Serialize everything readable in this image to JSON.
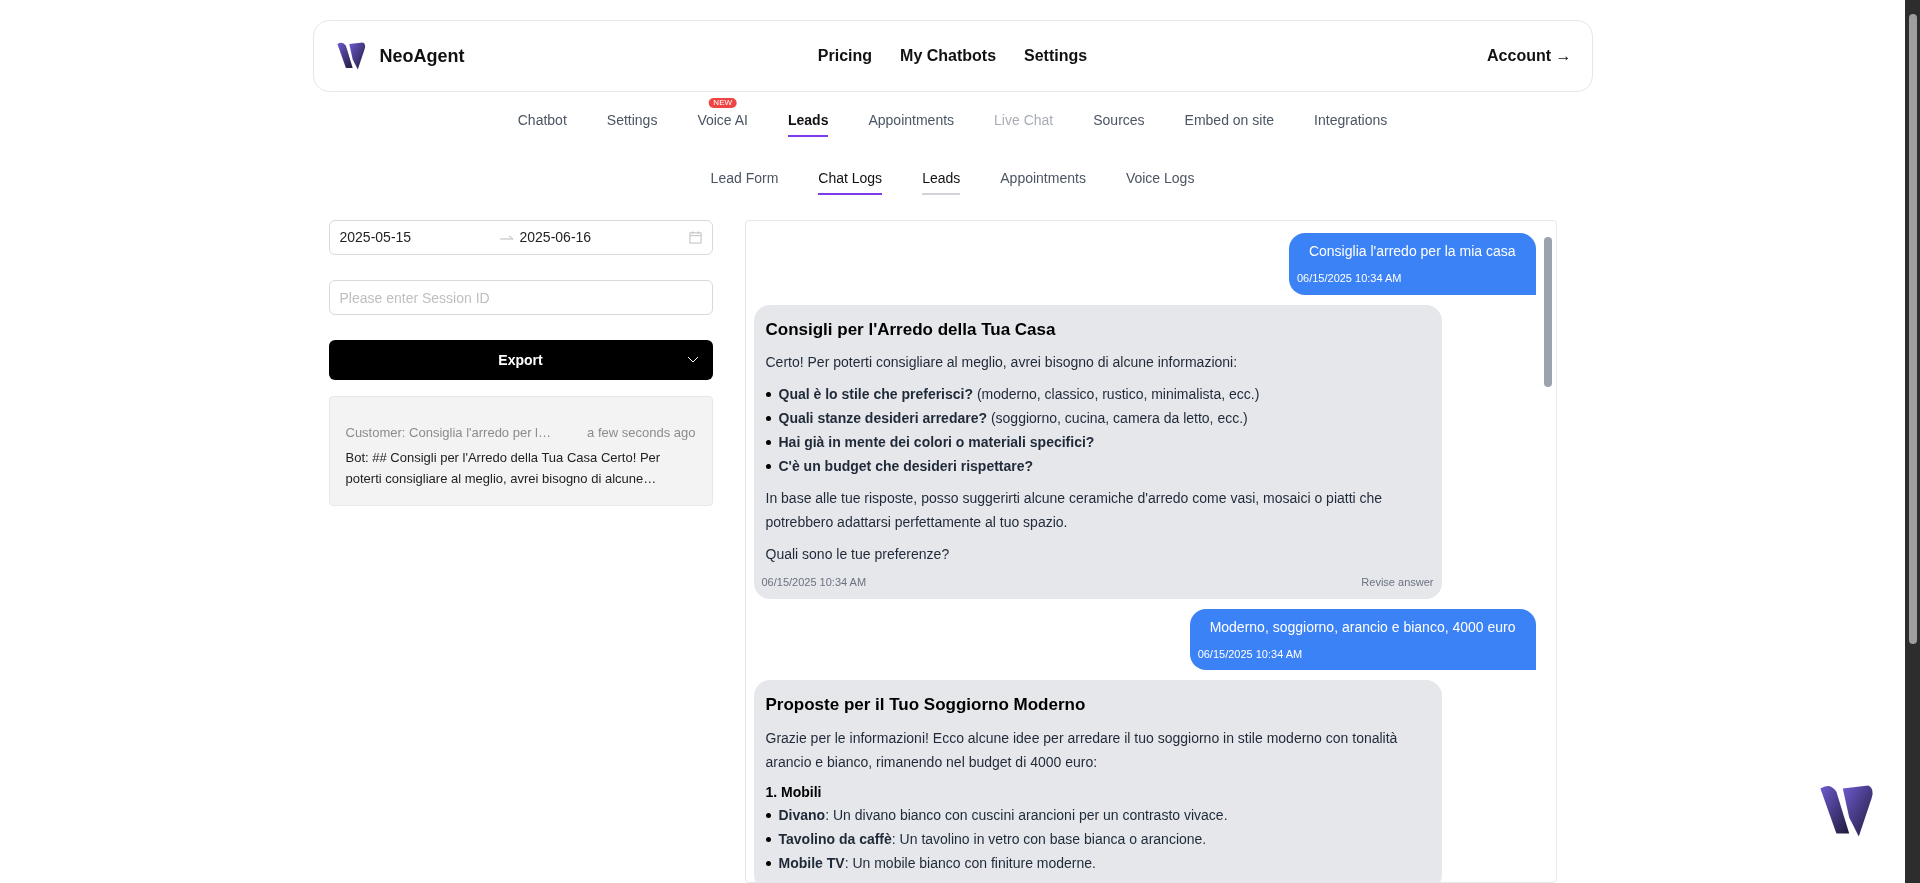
{
  "header": {
    "brand": "NeoAgent",
    "links": [
      "Pricing",
      "My Chatbots",
      "Settings"
    ],
    "account": "Account →"
  },
  "tabs": [
    {
      "label": "Chatbot",
      "selected": false,
      "disabled": false
    },
    {
      "label": "Settings",
      "selected": false,
      "disabled": false
    },
    {
      "label": "Voice AI",
      "selected": false,
      "disabled": false,
      "badge": "NEW"
    },
    {
      "label": "Leads",
      "selected": true,
      "disabled": false
    },
    {
      "label": "Appointments",
      "selected": false,
      "disabled": false
    },
    {
      "label": "Live Chat",
      "selected": false,
      "disabled": true
    },
    {
      "label": "Sources",
      "selected": false,
      "disabled": false
    },
    {
      "label": "Embed on site",
      "selected": false,
      "disabled": false
    },
    {
      "label": "Integrations",
      "selected": false,
      "disabled": false
    }
  ],
  "subtabs": [
    {
      "label": "Lead Form",
      "selected": false,
      "hovered": false
    },
    {
      "label": "Chat Logs",
      "selected": true,
      "hovered": false
    },
    {
      "label": "Leads",
      "selected": false,
      "hovered": true
    },
    {
      "label": "Appointments",
      "selected": false,
      "hovered": false
    },
    {
      "label": "Voice Logs",
      "selected": false,
      "hovered": false
    }
  ],
  "filters": {
    "date_from": "2025-05-15",
    "date_to": "2025-06-16",
    "session_placeholder": "Please enter Session ID",
    "export": "Export"
  },
  "sessions": [
    {
      "customer": "Customer: Consiglia l'arredo per l…",
      "time": "a few seconds ago",
      "bot": "Bot: ## Consigli per l'Arredo della Tua Casa Certo! Per poterti consigliare al meglio, avrei bisogno di alcune…",
      "selected": false
    }
  ],
  "messages": [
    {
      "kind": "user",
      "text": "Consiglia l'arredo per la mia casa",
      "time": "06/15/2025 10:34 AM"
    },
    {
      "kind": "bot",
      "time": "06/15/2025 10:34 AM",
      "action": "Revise answer",
      "blocks": [
        {
          "kind": "heading",
          "text": "Consigli per l'Arredo della Tua Casa"
        },
        {
          "kind": "paragraph",
          "text": "Certo! Per poterti consigliare al meglio, avrei bisogno di alcune informazioni:"
        },
        {
          "kind": "list",
          "items": [
            "**Qual è lo stile che preferisci?** (moderno, classico, rustico, minimalista, ecc.)",
            "**Quali stanze desideri arredare?** (soggiorno, cucina, camera da letto, ecc.)",
            "**Hai già in mente dei colori o materiali specifici?**",
            "**C'è un budget che desideri rispettare?**"
          ]
        },
        {
          "kind": "paragraph",
          "text": "In base alle tue risposte, posso suggerirti alcune ceramiche d'arredo come vasi, mosaici o piatti che potrebbero adattarsi perfettamente al tuo spazio."
        },
        {
          "kind": "paragraph",
          "text": "Quali sono le tue preferenze?"
        }
      ]
    },
    {
      "kind": "user",
      "text": "Moderno, soggiorno, arancio e bianco, 4000 euro",
      "time": "06/15/2025 10:34 AM"
    },
    {
      "kind": "bot",
      "blocks": [
        {
          "kind": "heading",
          "text": "Proposte per il Tuo Soggiorno Moderno"
        },
        {
          "kind": "paragraph",
          "text": "Grazie per le informazioni! Ecco alcune idee per arredare il tuo soggiorno in stile moderno con tonalità arancio e bianco, rimanendo nel budget di 4000 euro:"
        },
        {
          "kind": "subheading",
          "text": "1. Mobili"
        },
        {
          "kind": "list",
          "items": [
            "**Divano**: Un divano bianco con cuscini arancioni per un contrasto vivace.",
            "**Tavolino da caffè**: Un tavolino in vetro con base bianca o arancione.",
            "**Mobile TV**: Un mobile bianco con finiture moderne."
          ]
        }
      ]
    }
  ]
}
